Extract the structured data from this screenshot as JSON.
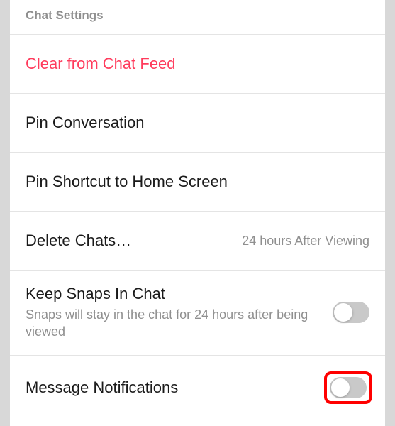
{
  "header": {
    "title": "Chat Settings"
  },
  "rows": {
    "clear": {
      "label": "Clear from Chat Feed"
    },
    "pinConversation": {
      "label": "Pin Conversation"
    },
    "pinShortcut": {
      "label": "Pin Shortcut to Home Screen"
    },
    "deleteChats": {
      "label": "Delete Chats…",
      "value": "24 hours After Viewing"
    },
    "keepSnaps": {
      "label": "Keep Snaps In Chat",
      "subtitle": "Snaps will stay in the chat for 24 hours after being viewed",
      "toggle": false
    },
    "messageNotifications": {
      "label": "Message Notifications",
      "toggle": false
    }
  }
}
